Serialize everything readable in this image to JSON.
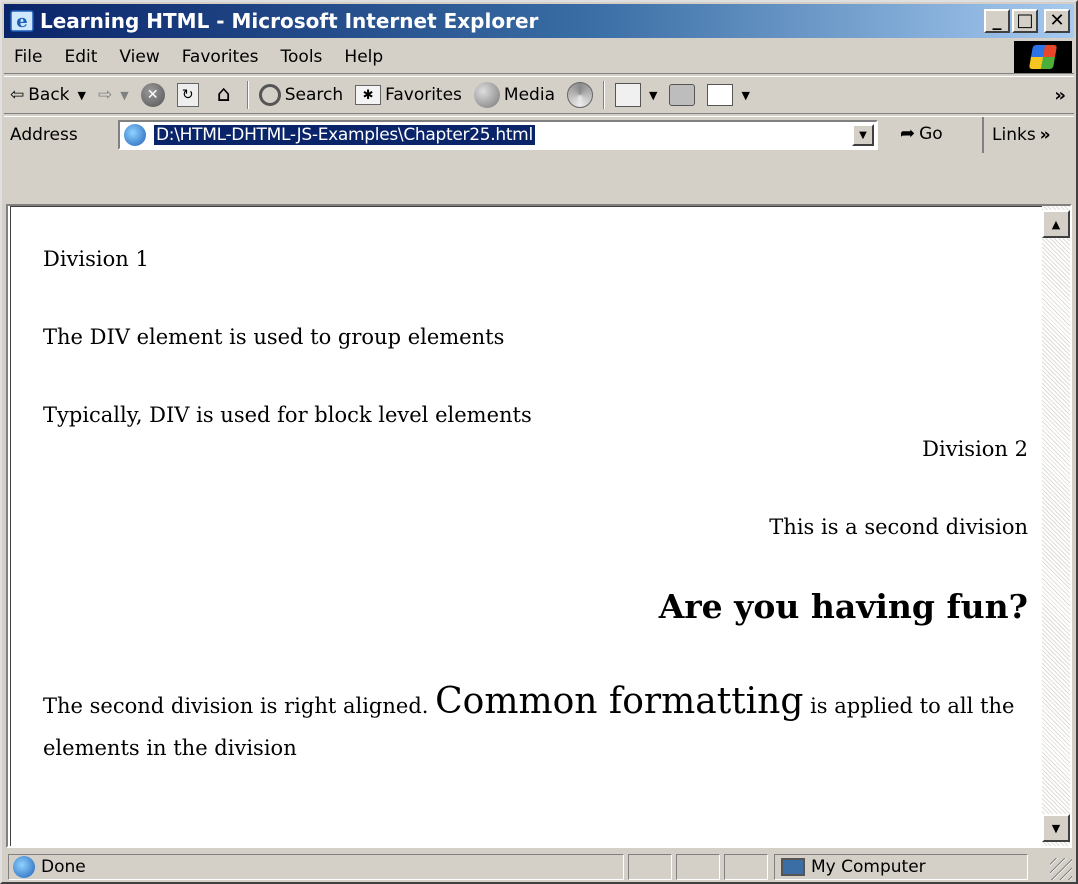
{
  "window": {
    "title": "Learning HTML - Microsoft Internet Explorer",
    "buttons": {
      "minimize": "_",
      "maximize": "□",
      "close": "✕"
    }
  },
  "menu": [
    "File",
    "Edit",
    "View",
    "Favorites",
    "Tools",
    "Help"
  ],
  "toolbar": {
    "back": "Back",
    "search": "Search",
    "favorites": "Favorites",
    "media": "Media",
    "more": "»"
  },
  "address": {
    "label": "Address",
    "url": "D:\\HTML-DHTML-JS-Examples\\Chapter25.html",
    "go": "Go",
    "links": "Links",
    "links_more": "»"
  },
  "content": {
    "div1_title": "Division 1",
    "div1_line2": "The DIV element is used to group elements",
    "div1_line3": "Typically, DIV is used for block level elements",
    "div2_title": "Division 2",
    "div2_line2": "This is a second division",
    "heading": "Are you having fun?",
    "para_part1": "The second division is right aligned.",
    "para_big": "Common formatting",
    "para_part2": "is applied to all the elements in the division"
  },
  "status": {
    "text": "Done",
    "zone": "My Computer"
  },
  "icons": {
    "app": "ie-icon",
    "stop": "stop-icon",
    "refresh": "refresh-icon",
    "home": "home-icon",
    "search": "search-icon",
    "favorites": "favorites-icon",
    "media": "media-icon",
    "history": "history-icon",
    "mail": "mail-icon",
    "print": "print-icon",
    "edit": "edit-icon"
  },
  "colors": {
    "titlebar_start": "#0a246a",
    "titlebar_end": "#a6caf0",
    "chrome": "#d4d0c8",
    "selection": "#0a246a"
  }
}
